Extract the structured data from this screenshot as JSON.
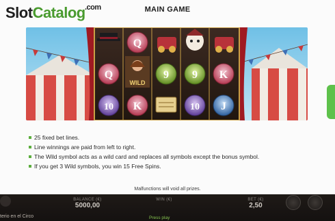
{
  "logo": {
    "part1": "Slot",
    "part2": "Catalog",
    "suffix": ".com"
  },
  "header": {
    "title": "MAIN GAME"
  },
  "reels": {
    "symbols": [
      [
        "top-hat",
        "Q",
        "9",
        "K",
        "10"
      ],
      [
        "Q",
        "wild",
        "K",
        "scroll",
        "10",
        "J"
      ],
      [
        "cannon",
        "harlequin",
        "9",
        "9",
        "cannon"
      ]
    ],
    "wild_label": "WILD"
  },
  "rules": [
    "25 fixed bet lines.",
    "Line winnings are paid from left to right.",
    "The Wild symbol acts as a wild card and replaces all symbols except the bonus symbol.",
    "If you get 3 Wild symbols, you win 15 Free Spins."
  ],
  "footer": {
    "malfunction": "Malfunctions will void all prizes."
  },
  "bottombar": {
    "balance_label": "BALANCE (€)",
    "balance_value": "5000,00",
    "win_label": "WIN (€)",
    "bet_label": "BET (€)",
    "bet_value": "2,50",
    "game_title": "terio en el Circo",
    "press_play": "Press play"
  },
  "colors": {
    "accent": "#5cae3e",
    "logo_green": "#4a9b2f",
    "curtain_red": "#b51e25"
  }
}
